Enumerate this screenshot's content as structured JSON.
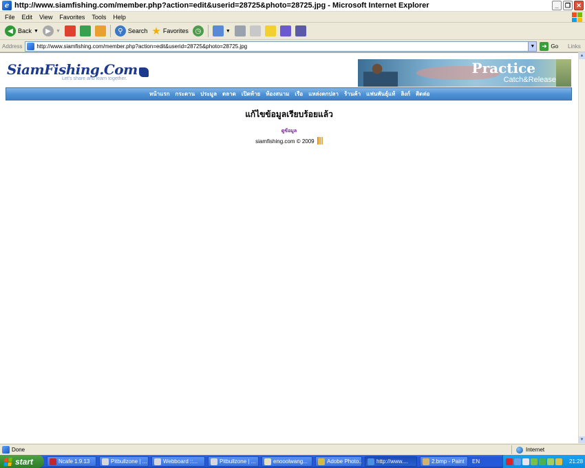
{
  "window": {
    "title": "http://www.siamfishing.com/member.php?action=edit&userid=28725&photo=28725.jpg - Microsoft Internet Explorer"
  },
  "menubar": [
    "File",
    "Edit",
    "View",
    "Favorites",
    "Tools",
    "Help"
  ],
  "toolbar": {
    "back_label": "Back",
    "search_label": "Search",
    "favorites_label": "Favorites"
  },
  "address": {
    "label": "Address",
    "url": "http://www.siamfishing.com/member.php?action=edit&userid=28725&photo=28725.jpg",
    "go_label": "Go",
    "links_label": "Links"
  },
  "page": {
    "logo_text": "SiamFishing.Com",
    "tagline": "Let's share and learn together.",
    "banner_line1": "Practice",
    "banner_line2": "Catch&Release",
    "nav": [
      "หน้าแรก",
      "กระดาน",
      "ประมูล",
      "ตลาด",
      "เปิดท้าย",
      "ท้องสนาม",
      "เรือ",
      "แหล่งตกปลา",
      "ร้านค้า",
      "แฟนพันธุ์แท้",
      "ลิงก์",
      "ติดต่อ"
    ],
    "message": "แก้ไขข้อมูลเรียบร้อยแล้ว",
    "view_link": "ดูข้อมูล",
    "footer": "siamfishing.com © 2009"
  },
  "statusbar": {
    "status": "Done",
    "zone": "Internet"
  },
  "taskbar": {
    "start_label": "start",
    "items": [
      {
        "label": "Ncafe 1.9.13",
        "color": "#c0262a"
      },
      {
        "label": "Pitbullzone | ...",
        "color": "#d7d7d7"
      },
      {
        "label": "Webboard ::...",
        "color": "#d7d7d7"
      },
      {
        "label": "Pitbullzone | ...",
        "color": "#d7d7d7"
      },
      {
        "label": "enooolwang...",
        "color": "#e8e0c0"
      },
      {
        "label": "Adobe Photo...",
        "color": "#d6b84a"
      },
      {
        "label": "http://www....",
        "color": "#4b8fe0"
      },
      {
        "label": "2.bmp - Paint",
        "color": "#d6b070"
      }
    ],
    "active_index": 6,
    "lang": "EN",
    "clock": "21:28"
  }
}
